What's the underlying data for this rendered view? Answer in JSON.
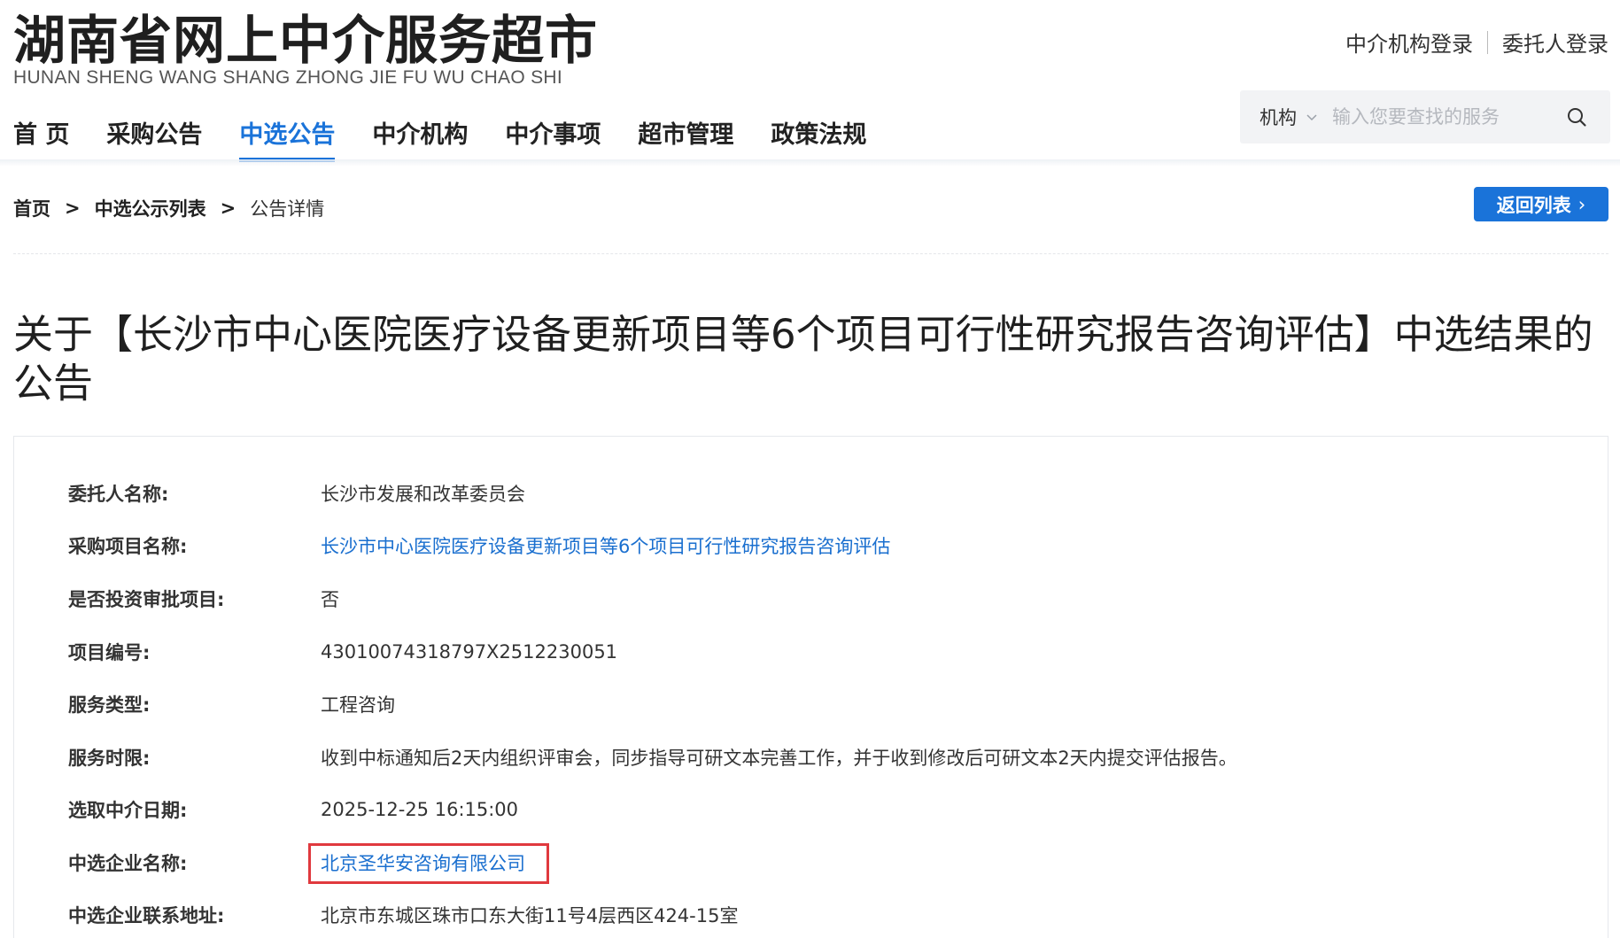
{
  "site": {
    "title": "湖南省网上中介服务超市",
    "subtitle": "HUNAN SHENG WANG SHANG ZHONG JIE FU WU CHAO SHI"
  },
  "top_links": {
    "agency_login": "中介机构登录",
    "client_login": "委托人登录"
  },
  "nav": {
    "items": [
      {
        "label": "首 页",
        "active": false
      },
      {
        "label": "采购公告",
        "active": false
      },
      {
        "label": "中选公告",
        "active": true
      },
      {
        "label": "中介机构",
        "active": false
      },
      {
        "label": "中介事项",
        "active": false
      },
      {
        "label": "超市管理",
        "active": false
      },
      {
        "label": "政策法规",
        "active": false
      }
    ]
  },
  "search": {
    "type_selected": "机构",
    "placeholder": "输入您要查找的服务"
  },
  "breadcrumb": {
    "items": [
      "首页",
      "中选公示列表",
      "公告详情"
    ],
    "separator": ">"
  },
  "back_button": {
    "label": "返回列表",
    "arrow": "›"
  },
  "notice": {
    "title": "关于【长沙市中心医院医疗设备更新项目等6个项目可行性研究报告咨询评估】中选结果的公告"
  },
  "details": [
    {
      "label": "委托人名称:",
      "value": "长沙市发展和改革委员会",
      "link": false
    },
    {
      "label": "采购项目名称:",
      "value": "长沙市中心医院医疗设备更新项目等6个项目可行性研究报告咨询评估",
      "link": true
    },
    {
      "label": "是否投资审批项目:",
      "value": "否",
      "link": false
    },
    {
      "label": "项目编号:",
      "value": "43010074318797X2512230051",
      "link": false
    },
    {
      "label": "服务类型:",
      "value": "工程咨询",
      "link": false
    },
    {
      "label": "服务时限:",
      "value": "收到中标通知后2天内组织评审会，同步指导可研文本完善工作，并于收到修改后可研文本2天内提交评估报告。",
      "link": false
    },
    {
      "label": "选取中介日期:",
      "value": "2025-12-25 16:15:00",
      "link": false
    },
    {
      "label": "中选企业名称:",
      "value": "北京圣华安咨询有限公司",
      "link": true
    },
    {
      "label": "中选企业联系地址:",
      "value": "北京市东城区珠市口东大街11号4层西区424-15室",
      "link": false
    }
  ],
  "colors": {
    "accent": "#1a73d9",
    "link": "#1a6fcf",
    "highlight_border": "#e0393e"
  }
}
